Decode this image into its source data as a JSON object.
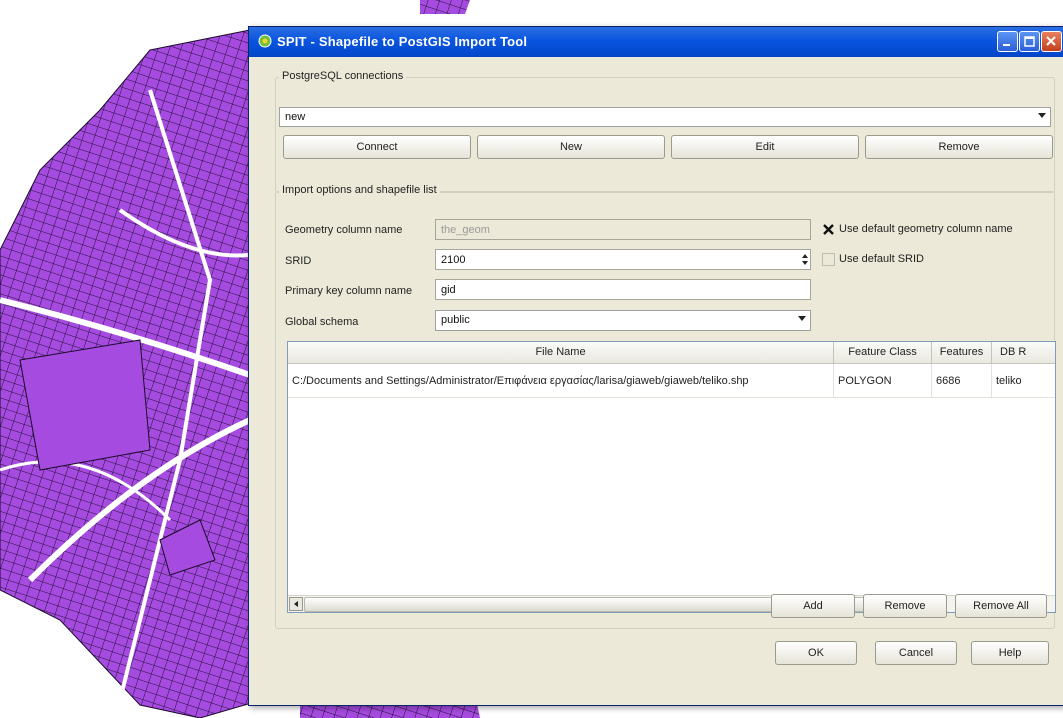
{
  "window": {
    "title": "SPIT - Shapefile to PostGIS Import Tool"
  },
  "connections": {
    "group_label": "PostgreSQL connections",
    "selected": "new",
    "buttons": {
      "connect": "Connect",
      "new": "New",
      "edit": "Edit",
      "remove": "Remove"
    }
  },
  "import_options": {
    "group_label": "Import options and shapefile list",
    "geometry_column": {
      "label": "Geometry column name",
      "value": "the_geom",
      "use_default_label": "Use default geometry column name",
      "use_default_checked": true
    },
    "srid": {
      "label": "SRID",
      "value": "2100",
      "use_default_label": "Use default SRID",
      "use_default_checked": false
    },
    "primary_key": {
      "label": "Primary key column name",
      "value": "gid"
    },
    "global_schema": {
      "label": "Global schema",
      "value": "public"
    }
  },
  "table": {
    "headers": [
      "File Name",
      "Feature Class",
      "Features",
      "DB R"
    ],
    "rows": [
      {
        "file_name": "C:/Documents and Settings/Administrator/Επιφάνεια εργασίας/larisa/giaweb/giaweb/teliko.shp",
        "feature_class": "POLYGON",
        "features": "6686",
        "db_relation": "teliko"
      }
    ]
  },
  "list_buttons": {
    "add": "Add",
    "remove": "Remove",
    "remove_all": "Remove All"
  },
  "dialog_buttons": {
    "ok": "OK",
    "cancel": "Cancel",
    "help": "Help"
  },
  "colors": {
    "map_fill": "#a64be0",
    "title_bar": "#0a55df",
    "dialog_bg": "#ece9d8"
  }
}
